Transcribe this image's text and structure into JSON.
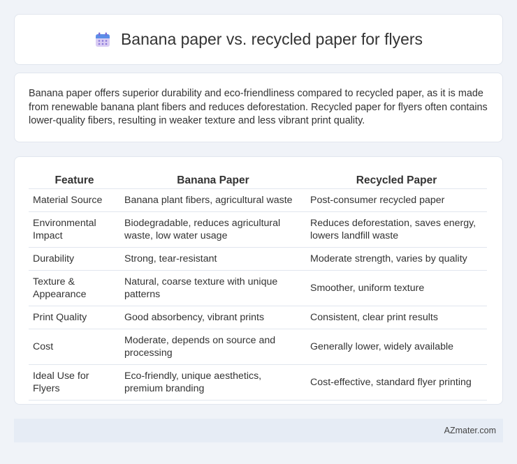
{
  "header": {
    "title": "Banana paper vs. recycled paper for flyers",
    "icon": "calendar-icon"
  },
  "summary": {
    "text": "Banana paper offers superior durability and eco-friendliness compared to recycled paper, as it is made from renewable banana plant fibers and reduces deforestation. Recycled paper for flyers often contains lower-quality fibers, resulting in weaker texture and less vibrant print quality."
  },
  "table": {
    "headers": [
      "Feature",
      "Banana Paper",
      "Recycled Paper"
    ],
    "rows": [
      [
        "Material Source",
        "Banana plant fibers, agricultural waste",
        "Post-consumer recycled paper"
      ],
      [
        "Environmental Impact",
        "Biodegradable, reduces agricultural waste, low water usage",
        "Reduces deforestation, saves energy, lowers landfill waste"
      ],
      [
        "Durability",
        "Strong, tear-resistant",
        "Moderate strength, varies by quality"
      ],
      [
        "Texture & Appearance",
        "Natural, coarse texture with unique patterns",
        "Smoother, uniform texture"
      ],
      [
        "Print Quality",
        "Good absorbency, vibrant prints",
        "Consistent, clear print results"
      ],
      [
        "Cost",
        "Moderate, depends on source and processing",
        "Generally lower, widely available"
      ],
      [
        "Ideal Use for Flyers",
        "Eco-friendly, unique aesthetics, premium branding",
        "Cost-effective, standard flyer printing"
      ]
    ]
  },
  "footer": {
    "brand": "AZmater.com"
  }
}
